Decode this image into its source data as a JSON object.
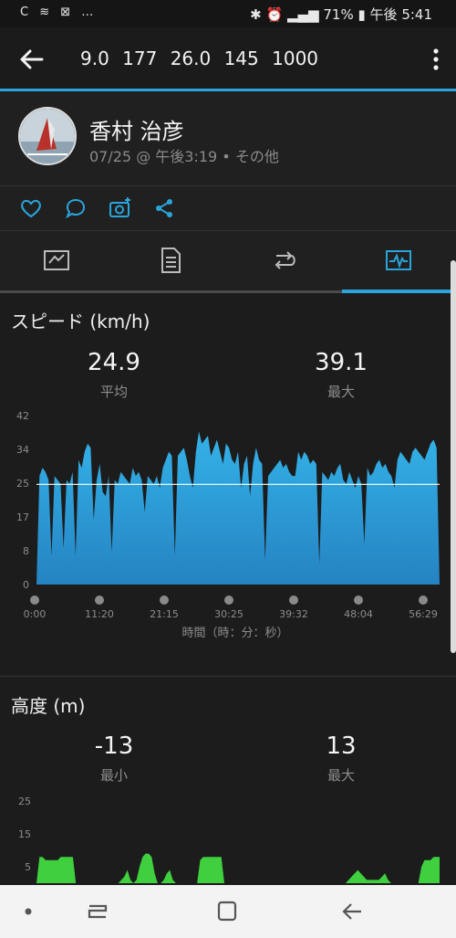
{
  "status_bar": {
    "left_icons": "C ≋ ⊠ …",
    "battery": "71%",
    "time": "午後 5:41"
  },
  "app_bar": {
    "title": "9.0  177  26.0  145 1000"
  },
  "activity": {
    "user_name": "香村 治彦",
    "meta": "07/25 @ 午後3:19 • その他"
  },
  "speed": {
    "title": "スピード (km/h)",
    "avg_value": "24.9",
    "avg_label": "平均",
    "max_value": "39.1",
    "max_label": "最大"
  },
  "altitude": {
    "title": "高度 (m)",
    "min_value": "-13",
    "min_label": "最小",
    "max_value": "13",
    "max_label": "最大"
  },
  "chart_data": [
    {
      "type": "area",
      "ylim": [
        0,
        42
      ],
      "y_ticks": [
        "42",
        "34",
        "25",
        "17",
        "8",
        "0"
      ],
      "x_ticks": [
        "0:00",
        "11:20",
        "21:15",
        "30:25",
        "39:32",
        "48:04",
        "56:29"
      ],
      "xlabel": "時間（時：分：秒）",
      "reference_line": 24.9,
      "color": "#2b9bd3",
      "values": [
        0,
        27,
        29,
        28,
        26,
        7,
        27,
        26,
        25,
        9,
        26,
        25,
        28,
        7,
        31,
        29,
        33,
        35,
        34,
        16,
        26,
        30,
        23,
        22,
        27,
        8,
        26,
        25,
        28,
        27,
        26,
        25,
        29,
        27,
        28,
        26,
        18,
        27,
        26,
        25,
        27,
        24,
        29,
        31,
        33,
        32,
        7,
        32,
        33,
        34,
        31,
        27,
        24,
        33,
        38,
        35,
        36,
        37,
        32,
        34,
        36,
        33,
        30,
        35,
        34,
        31,
        30,
        33,
        24,
        30,
        32,
        22,
        30,
        34,
        31,
        30,
        6,
        27,
        28,
        29,
        30,
        31,
        29,
        30,
        28,
        27,
        27,
        33,
        31,
        33,
        32,
        30,
        31,
        30,
        5,
        28,
        27,
        26,
        28,
        27,
        29,
        30,
        26,
        25,
        28,
        26,
        24,
        27,
        25,
        10,
        29,
        27,
        28,
        30,
        31,
        29,
        30,
        28,
        27,
        24,
        31,
        33,
        32,
        31,
        30,
        33,
        34,
        33,
        32,
        31,
        33,
        35,
        36,
        34,
        0
      ]
    },
    {
      "type": "area",
      "ylim": [
        0,
        25
      ],
      "y_ticks": [
        "25",
        "15",
        "5"
      ],
      "color": "#3fcf3f",
      "values": [
        0,
        8,
        8,
        7,
        7,
        7,
        7,
        7,
        8,
        8,
        8,
        8,
        8,
        0,
        0,
        0,
        0,
        0,
        0,
        0,
        0,
        0,
        0,
        0,
        0,
        0,
        0,
        0,
        1,
        2,
        4,
        1,
        0,
        1,
        5,
        8,
        9,
        9,
        8,
        3,
        0,
        0,
        1,
        3,
        4,
        1,
        0,
        0,
        0,
        0,
        0,
        0,
        0,
        0,
        7,
        8,
        8,
        8,
        8,
        8,
        8,
        8,
        0,
        0,
        0,
        0,
        0,
        0,
        0,
        0,
        0,
        0,
        0,
        0,
        0,
        0,
        0,
        0,
        0,
        0,
        0,
        0,
        0,
        0,
        0,
        0,
        0,
        0,
        0,
        0,
        0,
        0,
        0,
        0,
        0,
        0,
        0,
        0,
        0,
        0,
        0,
        0,
        0,
        1,
        2,
        3,
        4,
        3,
        2,
        1,
        1,
        1,
        1,
        1,
        2,
        3,
        1,
        0,
        0,
        0,
        0,
        0,
        0,
        0,
        0,
        0,
        0,
        5,
        7,
        7,
        7,
        8,
        8,
        8
      ]
    }
  ]
}
